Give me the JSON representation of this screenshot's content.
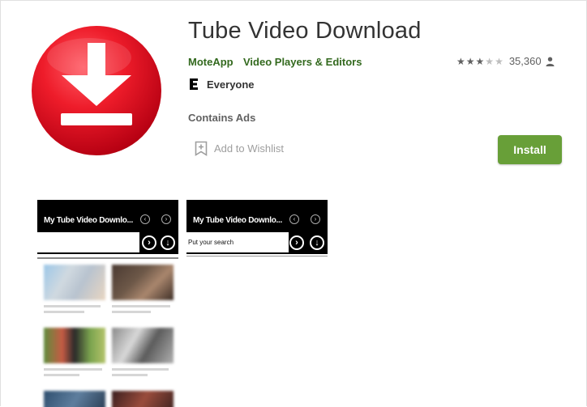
{
  "app": {
    "title": "Tube Video Download",
    "developer": "MoteApp",
    "category": "Video Players & Editors",
    "rating_stars": 3,
    "rating_max": 5,
    "rating_count": "35,360",
    "content_rating": "Everyone",
    "contains_ads": "Contains Ads",
    "wishlist_label": "Add to Wishlist",
    "install_label": "Install"
  },
  "icons": {
    "logo": "download-arrow-icon",
    "person": "person-icon",
    "bookmark": "bookmark-add-icon",
    "esrb": "esrb-everyone-icon"
  },
  "colors": {
    "logo_red": "#e2001a",
    "accent_green": "#689f38",
    "link_green": "#33691e",
    "gray_text": "#616161"
  },
  "screenshots": [
    {
      "app_title": "My Tube Video Downlo...",
      "search_text": "",
      "prev_symbol": "‹",
      "next_symbol": "›",
      "go_symbol": "›",
      "download_symbol": "↓"
    },
    {
      "app_title": "My Tube Video Downlo...",
      "search_text": "Put your search",
      "prev_symbol": "‹",
      "next_symbol": "›",
      "go_symbol": "›",
      "download_symbol": "↓"
    }
  ]
}
